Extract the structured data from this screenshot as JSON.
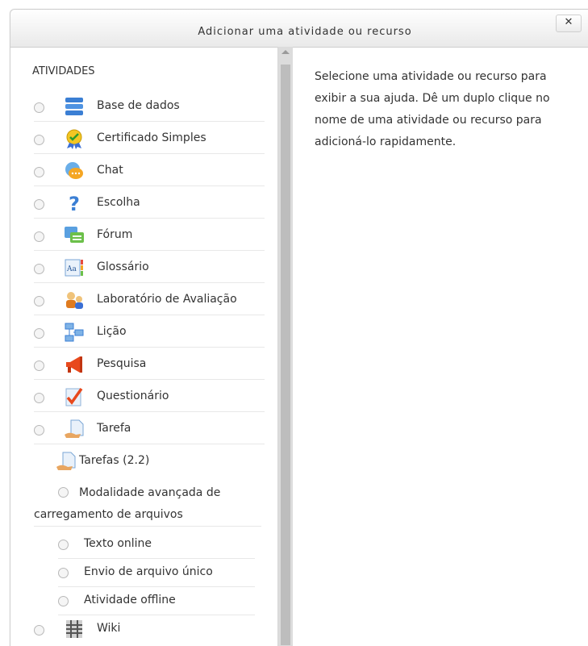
{
  "dialog": {
    "title": "Adicionar uma atividade ou recurso",
    "close_label": "✕"
  },
  "section_heading": "ATIVIDADES",
  "activities": [
    {
      "label": "Base de dados",
      "icon": "database-icon"
    },
    {
      "label": "Certificado Simples",
      "icon": "certificate-icon"
    },
    {
      "label": "Chat",
      "icon": "chat-icon"
    },
    {
      "label": "Escolha",
      "icon": "question-mark-icon"
    },
    {
      "label": "Fórum",
      "icon": "forum-icon"
    },
    {
      "label": "Glossário",
      "icon": "glossary-icon"
    },
    {
      "label": "Laboratório de Avaliação",
      "icon": "workshop-icon"
    },
    {
      "label": "Lição",
      "icon": "lesson-icon"
    },
    {
      "label": "Pesquisa",
      "icon": "megaphone-icon"
    },
    {
      "label": "Questionário",
      "icon": "quiz-checkmark-icon"
    },
    {
      "label": "Tarefa",
      "icon": "assignment-icon"
    }
  ],
  "tarefas_group": {
    "label": "Tarefas (2.2)",
    "icon": "assignment-icon"
  },
  "tarefas_subitems": [
    {
      "label": "Modalidade avançada de carregamento de arquivos"
    },
    {
      "label": "Texto online"
    },
    {
      "label": "Envio de arquivo único"
    },
    {
      "label": "Atividade offline"
    }
  ],
  "wiki": {
    "label": "Wiki",
    "icon": "wiki-icon"
  },
  "help_text": "Selecione uma atividade ou recurso para exibir a sua ajuda. Dê um duplo clique no nome de uma atividade ou recurso para adicioná-lo rapidamente."
}
